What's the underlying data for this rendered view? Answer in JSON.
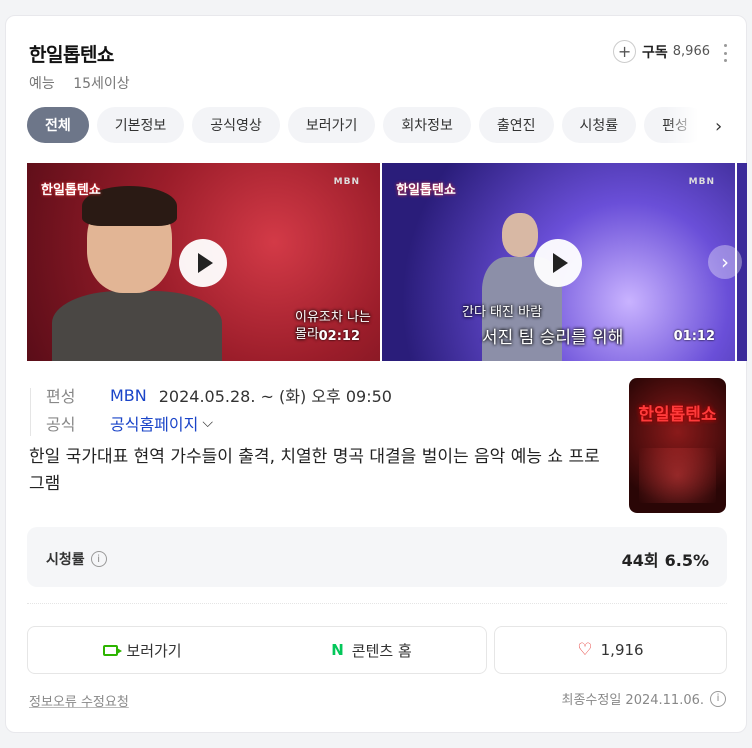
{
  "header": {
    "title": "한일톱텐쇼",
    "genre": "예능",
    "age_rating": "15세이상",
    "subscribe_label": "구독",
    "subscribe_count": "8,966"
  },
  "tabs": [
    {
      "label": "전체",
      "active": true
    },
    {
      "label": "기본정보"
    },
    {
      "label": "공식영상"
    },
    {
      "label": "보러가기"
    },
    {
      "label": "회차정보"
    },
    {
      "label": "출연진"
    },
    {
      "label": "시청률"
    },
    {
      "label": "편성"
    }
  ],
  "videos": [
    {
      "logo": "한일톱텐쇼",
      "badge": "MBN",
      "subtitle": "이유조차 나는 몰라",
      "duration": "02:12",
      "theme": "red"
    },
    {
      "logo": "한일톱텐쇼",
      "badge": "MBN",
      "subtitle_top": "간다 태진 바람",
      "subtitle": "서진 팀 승리를 위해",
      "duration": "01:12",
      "theme": "purple"
    }
  ],
  "info": {
    "schedule_label": "편성",
    "broadcaster": "MBN",
    "airtime": "2024.05.28. ~ (화) 오후 09:50",
    "official_label": "공식",
    "official_link": "공식홈페이지"
  },
  "description": "한일 국가대표 현역 가수들이 출격, 치열한 명곡 대결을 벌이는 음악 예능 쇼 프로그램",
  "poster": {
    "title": "한일톱텐쇼"
  },
  "ratings": {
    "label": "시청률",
    "episode": "44회",
    "value": "6.5%"
  },
  "actions": {
    "watch_label": "보러가기",
    "content_home_label": "콘텐츠 홈",
    "like_count": "1,916"
  },
  "footer": {
    "report_label": "정보오류 수정요청",
    "updated_label": "최종수정일 2024.11.06."
  },
  "colors": {
    "active_tab": "#6d7689",
    "link": "#1a44c8",
    "naver_green": "#03c75a",
    "heart": "#e53935"
  },
  "icons": [
    "plus-icon",
    "more-icon",
    "chevron-right-icon",
    "play-icon",
    "chevron-down-icon",
    "info-icon",
    "video-icon",
    "naver-n-icon",
    "heart-icon"
  ]
}
